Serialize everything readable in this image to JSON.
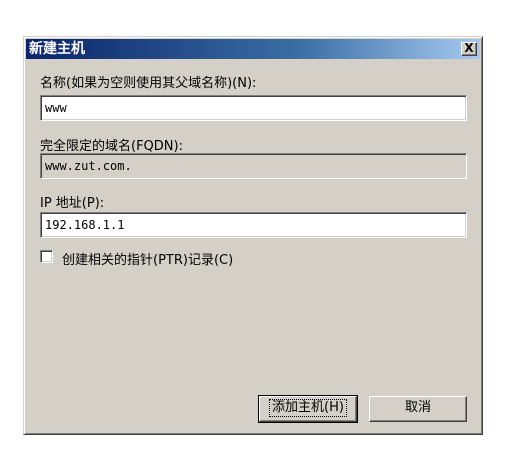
{
  "window": {
    "title": "新建主机",
    "close_label": "X"
  },
  "form": {
    "name_label": "名称(如果为空则使用其父域名称)(N):",
    "name_value": "www",
    "fqdn_label": "完全限定的域名(FQDN):",
    "fqdn_value": "www.zut.com.",
    "ip_label": "IP 地址(P):",
    "ip_value": "192.168.1.1",
    "ptr_checkbox_label": "创建相关的指针(PTR)记录(C)",
    "ptr_checked": false
  },
  "buttons": {
    "add_host_label": "添加主机(H)",
    "cancel_label": "取消"
  }
}
